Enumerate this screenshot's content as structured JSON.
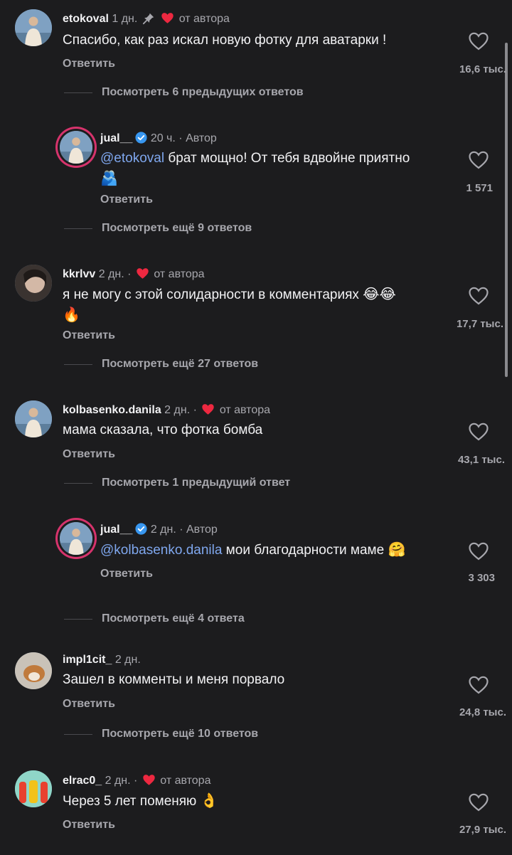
{
  "colors": {
    "background": "#1c1c1e",
    "heart_red": "#ed2840",
    "mention": "#7fa7ee",
    "verified_blue": "#3897f0"
  },
  "common": {
    "reply_label": "Ответить",
    "author_liked": "от автора",
    "author_badge": "Автор"
  },
  "comments": [
    {
      "username": "etokoval",
      "time": "1 дн.",
      "text": "Спасибо, как раз искал новую фотку для аватарки !",
      "likes": "16,6 тыс.",
      "pinned": true,
      "liked_by_author": true
    },
    {
      "more": "Посмотреть 6 предыдущих ответов"
    },
    {
      "username": "jual__",
      "time": "20 ч.",
      "mention": "@etokoval",
      "text": " брат мощно! От тебя вдвойне приятно",
      "emoji": "🫂",
      "likes": "1 571",
      "is_author": true
    },
    {
      "more": "Посмотреть ещё 9 ответов"
    },
    {
      "username": "kkrlvv",
      "time": "2 дн.",
      "text": "я не могу с этой солидарности в комментариях ",
      "emoji": "😂😂",
      "emoji2": "🔥",
      "likes": "17,7 тыс.",
      "liked_by_author": true
    },
    {
      "more": "Посмотреть ещё 27 ответов"
    },
    {
      "username": "kolbasenko.danila",
      "time": "2 дн.",
      "text": "мама сказала, что фотка бомба",
      "likes": "43,1 тыс.",
      "liked_by_author": true
    },
    {
      "more": "Посмотреть 1 предыдущий ответ"
    },
    {
      "username": "jual__",
      "time": "2 дн.",
      "mention": "@kolbasenko.danila",
      "text": " мои благодарности маме ",
      "emoji": "🤗",
      "likes": "3 303",
      "is_author": true
    },
    {
      "more": "Посмотреть ещё 4 ответа"
    },
    {
      "username": "impl1cit_",
      "time": "2 дн.",
      "text": "Зашел в комменты и меня порвало",
      "likes": "24,8 тыс."
    },
    {
      "more": "Посмотреть ещё 10 ответов"
    },
    {
      "username": "elrac0_",
      "time": "2 дн.",
      "text": "Через 5 лет поменяю ",
      "emoji": "👌",
      "likes": "27,9 тыс.",
      "liked_by_author": true
    }
  ]
}
